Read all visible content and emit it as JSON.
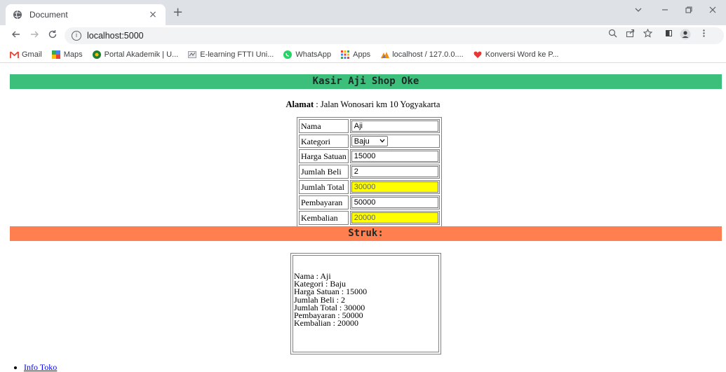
{
  "browser": {
    "tab_title": "Document",
    "tab_close": "×",
    "new_tab": "+",
    "url": "localhost:5000",
    "bookmarks": [
      {
        "label": "Gmail",
        "icon": "gmail-icon",
        "color": "#ea4335"
      },
      {
        "label": "Maps",
        "icon": "maps-icon",
        "color": "#34a853"
      },
      {
        "label": "Portal Akademik | U...",
        "icon": "portal-icon",
        "color": "#1e7e34"
      },
      {
        "label": "E-learning FTTI Uni...",
        "icon": "elearning-icon",
        "color": "#9aa0a6"
      },
      {
        "label": "WhatsApp",
        "icon": "whatsapp-icon",
        "color": "#25d366"
      },
      {
        "label": "Apps",
        "icon": "apps-icon",
        "color": "#fbbc04"
      },
      {
        "label": "localhost / 127.0.0....",
        "icon": "phpmyadmin-icon",
        "color": "#f29111"
      },
      {
        "label": "Konversi Word ke P...",
        "icon": "heart-icon",
        "color": "#e53935"
      }
    ]
  },
  "page": {
    "heading": "Kasir Aji Shop Oke",
    "alamat_label": "Alamat",
    "alamat_value": " : Jalan Wonosari km 10 Yogyakarta",
    "form": {
      "nama_label": "Nama",
      "nama_value": "Aji",
      "kategori_label": "Kategori",
      "kategori_value": "Baju",
      "harga_label": "Harga Satuan",
      "harga_value": "15000",
      "jumlah_label": "Jumlah Beli",
      "jumlah_value": "2",
      "total_label": "Jumlah Total",
      "total_value": "30000",
      "bayar_label": "Pembayaran",
      "bayar_value": "50000",
      "kembali_label": "Kembalian",
      "kembali_value": "20000"
    },
    "struk_heading": "Struk:",
    "struk_lines": [
      "Nama : Aji",
      "Kategori : Baju",
      "Harga Satuan : 15000",
      "Jumlah Beli : 2",
      "Jumlah Total : 30000",
      "Pembayaran : 50000",
      "Kembalian : 20000"
    ],
    "link_label": "Info Toko"
  },
  "colors": {
    "header_bar": "#3cbf7b",
    "struk_bar": "#ff7f50",
    "highlight": "#ffff00"
  }
}
